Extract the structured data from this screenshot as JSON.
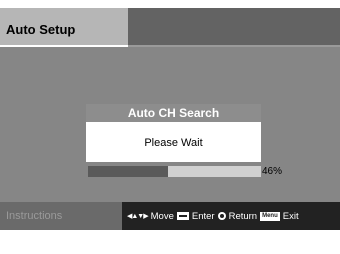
{
  "header": {
    "title": "Auto Setup"
  },
  "dialog": {
    "title": "Auto CH Search",
    "message": "Please Wait",
    "progress_percent": 46,
    "progress_label": "46%"
  },
  "footer": {
    "instructions_label": "Instructions",
    "keys": {
      "move_label": "Move",
      "enter_label": "Enter",
      "return_label": "Return",
      "menu_key_label": "Menu",
      "exit_label": "Exit"
    }
  },
  "icons": {
    "move": "arrows-icon",
    "enter": "enter-key-icon",
    "return": "return-key-icon",
    "menu": "menu-key-icon"
  },
  "colors": {
    "background": "#868686",
    "header_dark": "#636363",
    "title_tab": "#b6b6b6",
    "footer": "#222222",
    "progress_fill": "#5a5a5a",
    "progress_track": "#d0d0d0"
  }
}
